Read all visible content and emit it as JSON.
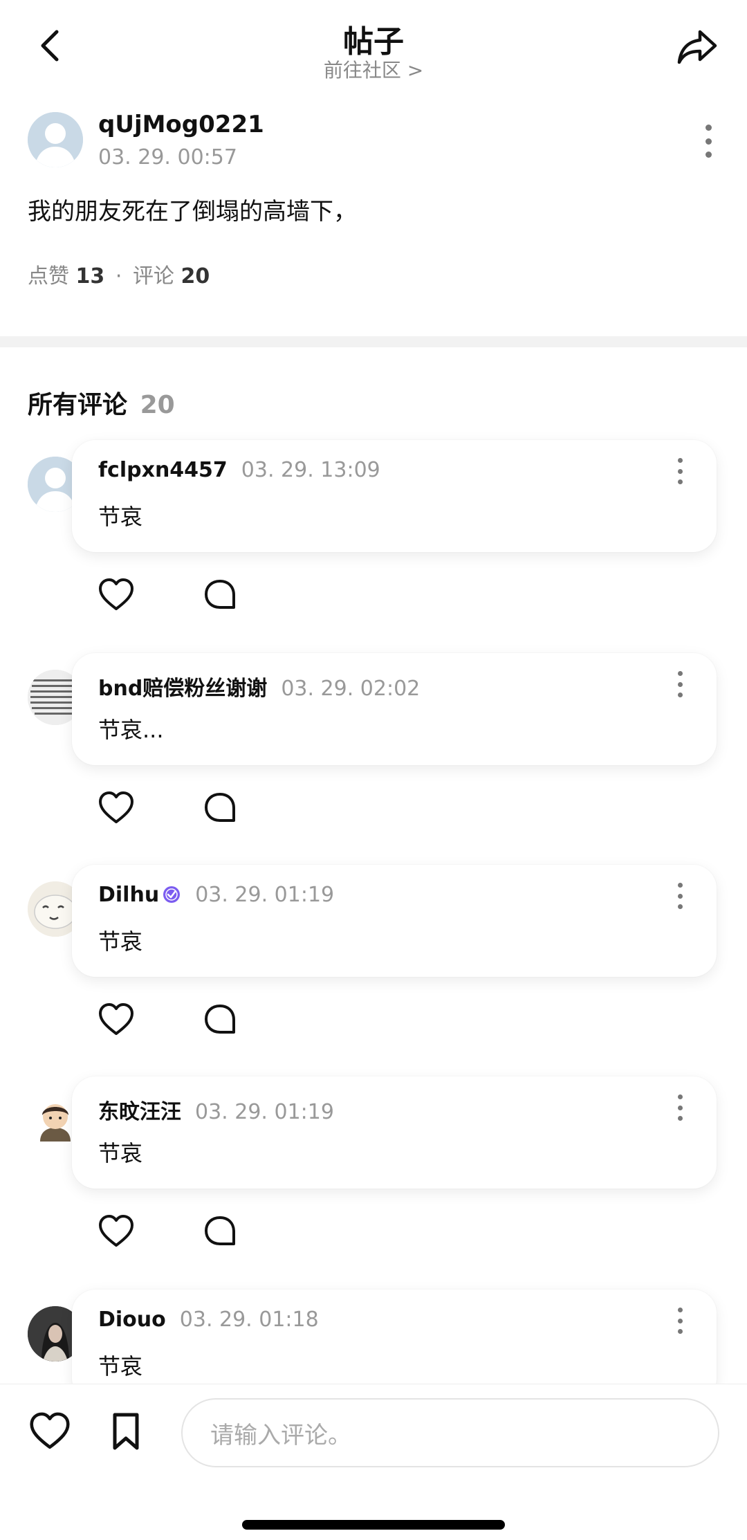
{
  "header": {
    "title": "帖子",
    "subtitle": "前往社区 >"
  },
  "post": {
    "username": "qUjMog0221",
    "time": "03. 29. 00:57",
    "body": "我的朋友死在了倒塌的高墙下，",
    "likes_label": "点赞",
    "likes": "13",
    "separator": "·",
    "comments_label": "评论",
    "comments": "20"
  },
  "comments_section": {
    "title": "所有评论",
    "count": "20"
  },
  "comments": [
    {
      "name": "fclpxn4457",
      "time": "03. 29. 13:09",
      "text": "节哀"
    },
    {
      "name": "bnd赔偿粉丝谢谢",
      "time": "03. 29. 02:02",
      "text": "节哀..."
    },
    {
      "name": "Dilhu",
      "time": "03. 29. 01:19",
      "text": "节哀"
    },
    {
      "name": "东旼汪汪",
      "time": "03. 29. 01:19",
      "text": "节哀"
    },
    {
      "name": "Diouo",
      "time": "03. 29. 01:18",
      "text": "节哀"
    }
  ],
  "bottom_bar": {
    "input_placeholder": "请输入评论。"
  },
  "icons": {
    "back": "chevron-left-icon",
    "share": "share-icon",
    "more": "more-vertical-icon",
    "like": "heart-icon",
    "reply": "comment-bubble-icon",
    "bookmark": "bookmark-icon",
    "verified": "verified-badge-icon"
  },
  "colors": {
    "text_primary": "#111111",
    "text_secondary": "#999999",
    "verified_badge": "#7b5cf0"
  }
}
